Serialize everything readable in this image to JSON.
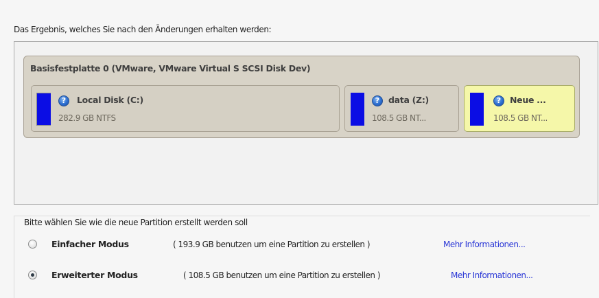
{
  "result_label": "Das Ergebnis, welches Sie nach den Änderungen erhalten werden:",
  "disk": {
    "title": "Basisfestplatte 0 (VMware, VMware Virtual S SCSI Disk Dev)",
    "partitions": [
      {
        "name": "Local Disk (C:)",
        "detail": "282.9 GB NTFS",
        "selected": false,
        "bar_color": "#0b0de4"
      },
      {
        "name": "data (Z:)",
        "detail": "108.5 GB NT...",
        "selected": false,
        "bar_color": "#0b0de4"
      },
      {
        "name": "Neue ...",
        "detail": "108.5 GB NT...",
        "selected": true,
        "bar_color": "#0b0de4"
      }
    ]
  },
  "mode_group": {
    "legend": "Bitte wählen Sie wie die neue Partition erstellt werden soll",
    "options": [
      {
        "name": "Einfacher Modus",
        "description": "( 193.9 GB benutzen um eine Partition zu erstellen )",
        "link": "Mehr Informationen...",
        "checked": false
      },
      {
        "name": "Erweiterter Modus",
        "description": "( 108.5 GB benutzen um eine Partition zu erstellen )",
        "link": "Mehr Informationen...",
        "checked": true
      }
    ]
  },
  "colors": {
    "partition_bar": "#0b0de4",
    "selected_partition": "#f5f7a9",
    "link": "#2a37d6"
  }
}
